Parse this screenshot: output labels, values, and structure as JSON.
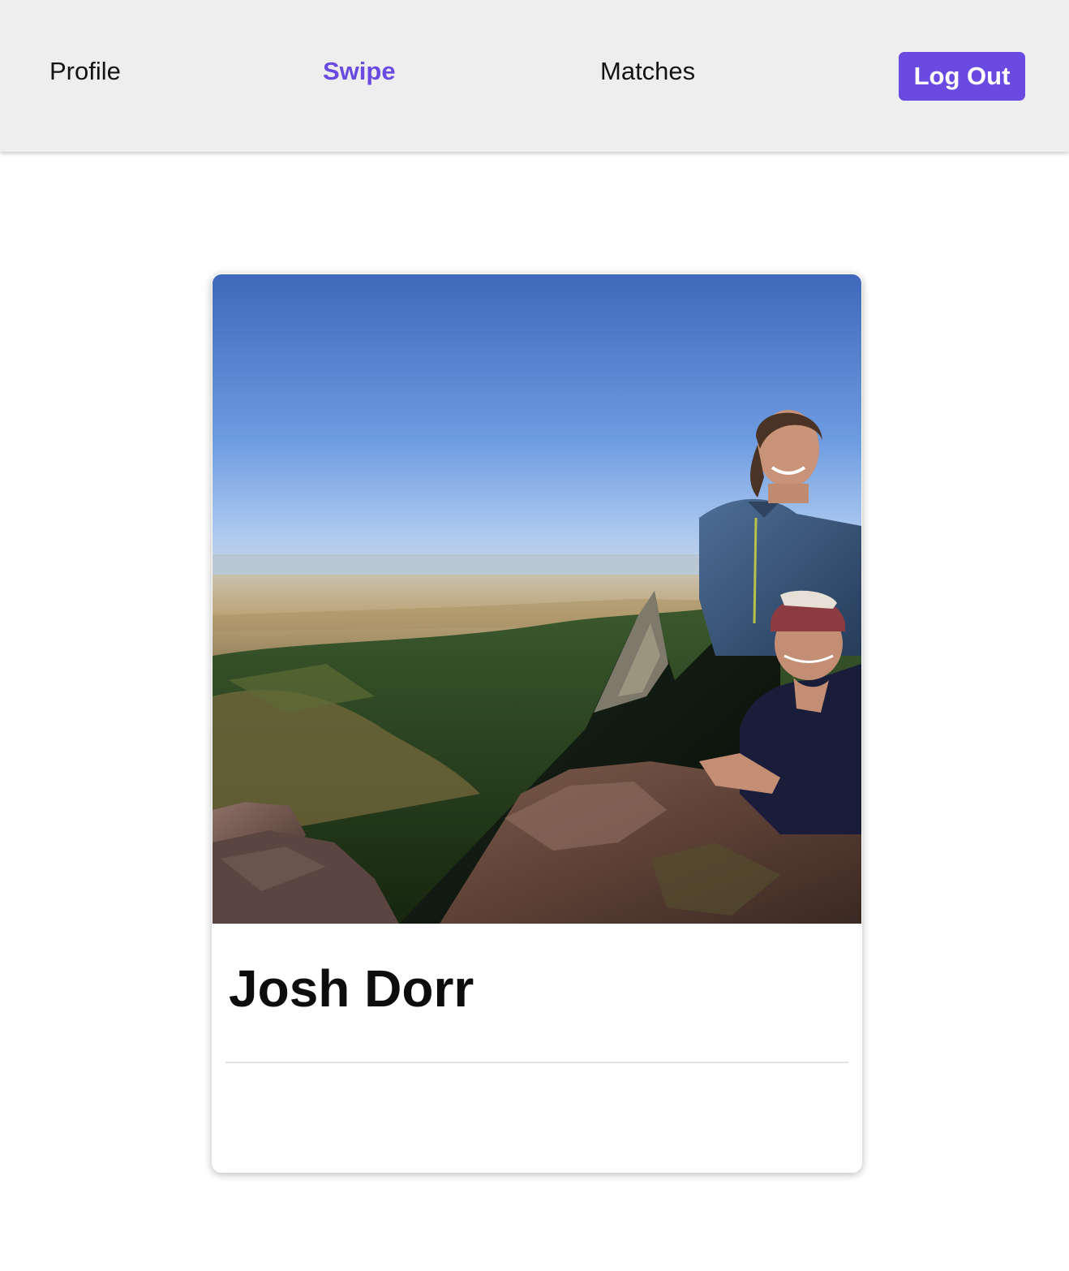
{
  "nav": {
    "profile_label": "Profile",
    "swipe_label": "Swipe",
    "matches_label": "Matches",
    "logout_label": "Log Out",
    "active_tab": "swipe"
  },
  "card": {
    "name": "Josh Dorr",
    "photo_alt": "Two people smiling on a rocky mountain summit above a valley"
  },
  "colors": {
    "accent": "#6a4be2",
    "navbar_bg": "#eeeeee"
  }
}
